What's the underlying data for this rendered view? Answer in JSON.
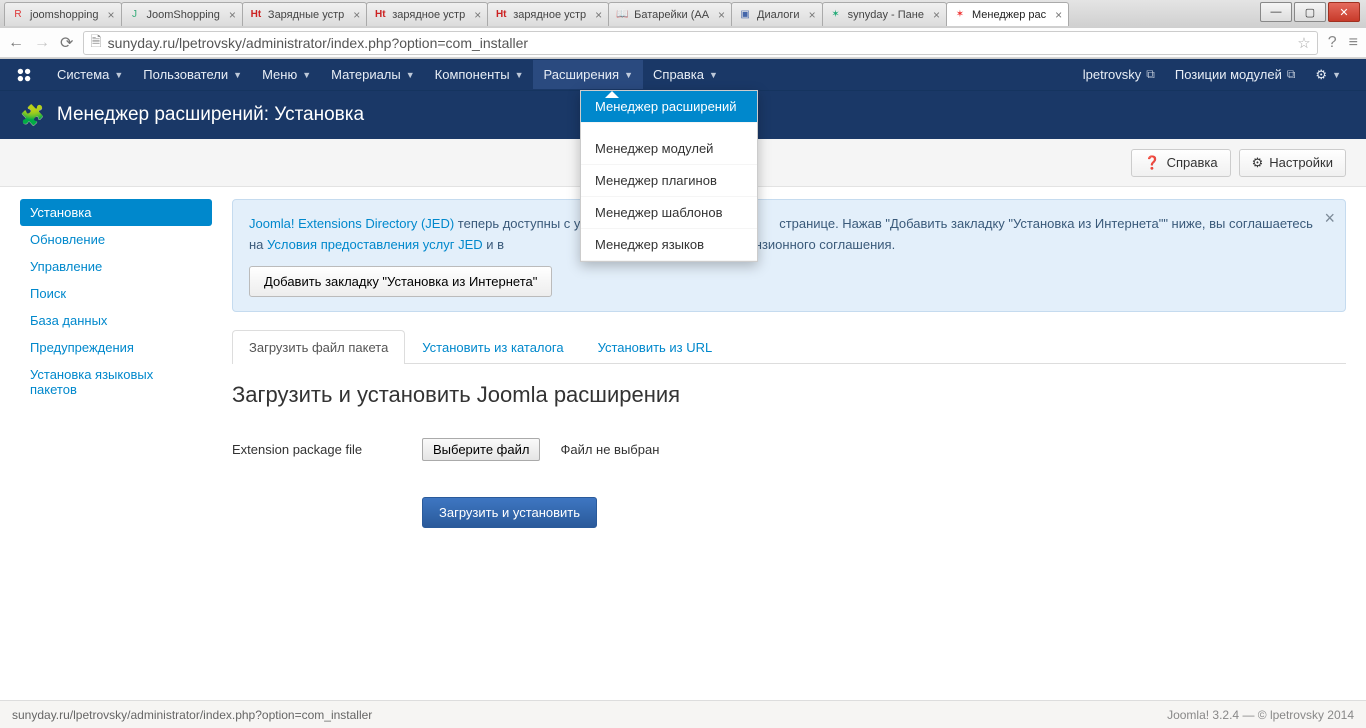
{
  "browser": {
    "tabs": [
      {
        "label": "joomshopping",
        "icon": "R",
        "icon_color": "#d33"
      },
      {
        "label": "JoomShopping",
        "icon": "J",
        "icon_color": "#3a7"
      },
      {
        "label": "Зарядные устр",
        "icon": "Ht",
        "icon_color": "#c22"
      },
      {
        "label": "зарядное устр",
        "icon": "Ht",
        "icon_color": "#c22"
      },
      {
        "label": "зарядное устр",
        "icon": "Ht",
        "icon_color": "#c22"
      },
      {
        "label": "Батарейки (АА",
        "icon": "📖",
        "icon_color": "#555"
      },
      {
        "label": "Диалоги",
        "icon": "▣",
        "icon_color": "#46a"
      },
      {
        "label": "synyday - Пане",
        "icon": "✶",
        "icon_color": "#2a7"
      },
      {
        "label": "Менеджер рас",
        "icon": "✶",
        "icon_color": "#e33",
        "active": true
      }
    ],
    "url": "sunyday.ru/lpetrovsky/administrator/index.php?option=com_installer"
  },
  "menubar": {
    "items": [
      "Система",
      "Пользователи",
      "Меню",
      "Материалы",
      "Компоненты",
      "Расширения",
      "Справка"
    ],
    "active_index": 5,
    "user": "lpetrovsky",
    "positions": "Позиции модулей"
  },
  "dropdown": {
    "items": [
      "Менеджер расширений",
      "Менеджер модулей",
      "Менеджер плагинов",
      "Менеджер шаблонов",
      "Менеджер языков"
    ],
    "active_index": 0
  },
  "header": {
    "title": "Менеджер расширений: Установка"
  },
  "toolbar": {
    "help": "Справка",
    "settings": "Настройки"
  },
  "sidebar": {
    "items": [
      "Установка",
      "Обновление",
      "Управление",
      "Поиск",
      "База данных",
      "Предупреждения",
      "Установка языковых пакетов"
    ],
    "active_index": 0
  },
  "alert": {
    "link1": "Joomla! Extensions Directory (JED)",
    "text1": " теперь доступны с ус",
    "text1b": "странице.  Нажав \"Добавить закладку \"Установка из Интернета\"\" ниже, вы соглашаетесь на ",
    "link2": "Условия предоставления услуг JED",
    "text2": " и в",
    "text2b": "ной условия лицензионного соглашения.",
    "button": "Добавить закладку \"Установка из Интернета\""
  },
  "tabs": {
    "items": [
      "Загрузить файл пакета",
      "Установить из каталога",
      "Установить из URL"
    ],
    "active_index": 0
  },
  "page": {
    "heading": "Загрузить и установить Joomla расширения",
    "file_label": "Extension package file",
    "choose_btn": "Выберите файл",
    "file_status": "Файл не выбран",
    "upload_btn": "Загрузить и установить"
  },
  "footer": {
    "status": "sunyday.ru/lpetrovsky/administrator/index.php?option=com_installer",
    "version": "Joomla! 3.2.4 ",
    "copyright": "— © lpetrovsky 2014"
  }
}
